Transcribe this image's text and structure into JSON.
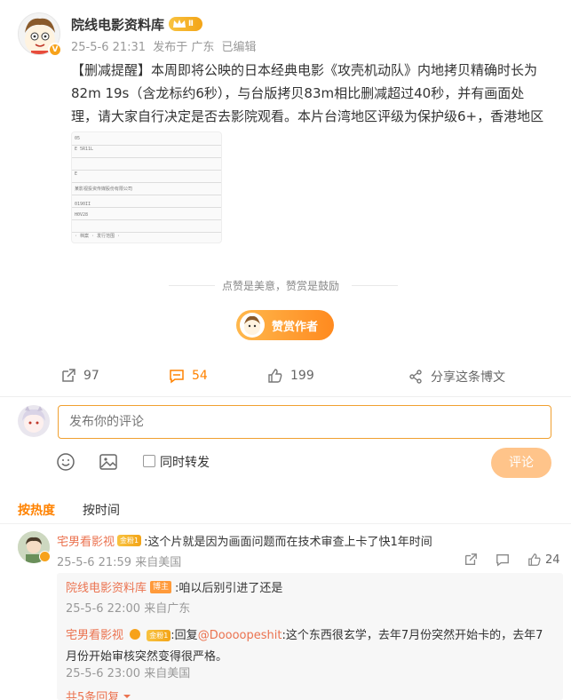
{
  "post": {
    "author_name": "院线电影资料库",
    "author_level": "Ⅱ",
    "v_mark": "V",
    "time": "25-5-6 21:31",
    "source": "发布于 广东",
    "edited": "已编辑",
    "text": "【删减提醒】本周即将公映的日本经典电影《攻壳机动队》内地拷贝精确时长为82m 19s（含龙标约6秒），与台版拷贝83m相比删减超过40秒，并有画面处理，请大家自行决定是否去影院观看。本片台湾地区评级为保护级6+，香港地区IIB。",
    "image_lines": [
      "05",
      "E 5R11L",
      "E",
      "某影视投资传媒股份有限公司",
      "0190II",
      "H0V28",
      "· 档案 · 发行范围 ·"
    ],
    "like_hint": "点赞是美意，赞赏是鼓励",
    "reward_label": "赞赏作者"
  },
  "actions": {
    "repost_count": "97",
    "comment_count": "54",
    "like_count": "199",
    "share_label": "分享这条博文"
  },
  "composer": {
    "placeholder": "发布你的评论",
    "repost_label": "同时转发",
    "submit_label": "评论"
  },
  "sort": {
    "hot_label": "按热度",
    "time_label": "按时间"
  },
  "comment": {
    "author": "宅男看影视",
    "level": "金粉1",
    "text": ":这个片就是因为画面问题而在技术审查上卡了快1年时间",
    "time": "25-5-6 21:59 来自美国",
    "likes": "24"
  },
  "replies": [
    {
      "author": "院线电影资料库",
      "tag": "博主",
      "text": ":咱以后别引进了还是",
      "time": "25-5-6 22:00 来自广东"
    },
    {
      "author": "宅男看影视",
      "level": "金粉1",
      "reply_prefix": ":回复",
      "mention": "@Doooopeshit",
      "text": ":这个东西很玄学，去年7月份突然开始卡的，去年7月份开始审核突然变得很严格。",
      "time": "25-5-6 23:00 来自美国"
    }
  ],
  "more_replies": "共5条回复",
  "colors": {
    "accent": "#ff8200",
    "name": "#eb7350",
    "link": "#eb7350"
  }
}
